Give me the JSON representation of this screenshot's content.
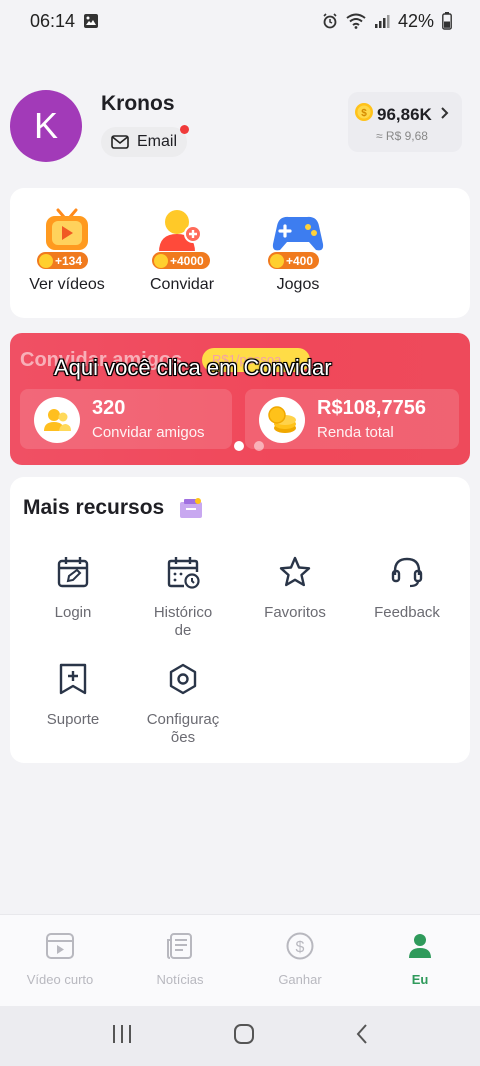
{
  "status_bar": {
    "time": "06:14",
    "battery": "42%"
  },
  "profile": {
    "avatar_letter": "K",
    "username": "Kronos",
    "email_label": "Email",
    "coins": "96,86K",
    "coins_value": "≈ R$ 9,68"
  },
  "features": [
    {
      "label": "Ver vídeos",
      "badge": "+134",
      "icon": "tv-play-icon"
    },
    {
      "label": "Convidar",
      "badge": "+4000",
      "icon": "invite-person-icon"
    },
    {
      "label": "Jogos",
      "badge": "+400",
      "icon": "gamepad-icon"
    }
  ],
  "invite": {
    "title": "Convidar amigos",
    "pill": "R$1/pessoa",
    "caption": "Aqui você clica em Convidar",
    "friends_count": "320",
    "friends_label": "Convidar amigos",
    "income": "R$108,7756",
    "income_label": "Renda total"
  },
  "more": {
    "title": "Mais recursos",
    "items": [
      {
        "label": "Login",
        "icon": "calendar-edit-icon"
      },
      {
        "label": "Histórico de",
        "icon": "calendar-clock-icon"
      },
      {
        "label": "Favoritos",
        "icon": "star-icon"
      },
      {
        "label": "Feedback",
        "icon": "headset-icon"
      },
      {
        "label": "Suporte",
        "icon": "bookmark-plus-icon"
      },
      {
        "label": "Configuraç ões",
        "icon": "hexagon-settings-icon"
      }
    ]
  },
  "bottom_nav": [
    {
      "label": "Vídeo curto",
      "icon": "video-icon"
    },
    {
      "label": "Notícias",
      "icon": "news-icon"
    },
    {
      "label": "Ganhar",
      "icon": "dollar-icon"
    },
    {
      "label": "Eu",
      "icon": "person-icon"
    }
  ],
  "colors": {
    "accent_green": "#2f9a5b",
    "invite_red": "#f0485a",
    "coin_gold": "#ffcf2e"
  }
}
